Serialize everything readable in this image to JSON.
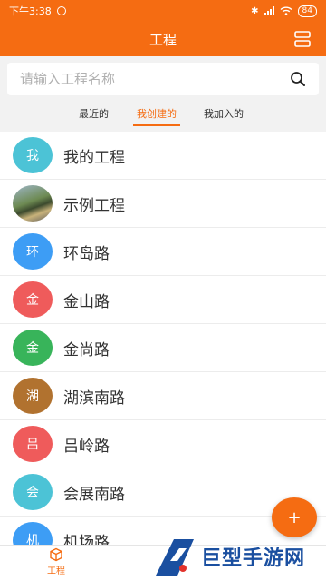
{
  "status_bar": {
    "time": "下午3:38",
    "battery": "84"
  },
  "header": {
    "title": "工程"
  },
  "search": {
    "placeholder": "请输入工程名称",
    "value": ""
  },
  "tabs": [
    {
      "label": "最近的",
      "active": false
    },
    {
      "label": "我创建的",
      "active": true
    },
    {
      "label": "我加入的",
      "active": false
    }
  ],
  "projects": [
    {
      "avatar_text": "我",
      "name": "我的工程",
      "color": "#4cc3d6"
    },
    {
      "avatar_text": "",
      "name": "示例工程",
      "color": "photo"
    },
    {
      "avatar_text": "环",
      "name": "环岛路",
      "color": "#3d9df5"
    },
    {
      "avatar_text": "金",
      "name": "金山路",
      "color": "#ef5b5b"
    },
    {
      "avatar_text": "金",
      "name": "金尚路",
      "color": "#38b45a"
    },
    {
      "avatar_text": "湖",
      "name": "湖滨南路",
      "color": "#b1722f"
    },
    {
      "avatar_text": "吕",
      "name": "吕岭路",
      "color": "#ef5b5b"
    },
    {
      "avatar_text": "会",
      "name": "会展南路",
      "color": "#4cc3d6"
    },
    {
      "avatar_text": "机",
      "name": "机场路",
      "color": "#3d9df5"
    }
  ],
  "fab": {
    "label": "+"
  },
  "bottom_nav": {
    "items": [
      {
        "label": "工程",
        "icon": "box-icon",
        "active": true
      }
    ]
  },
  "watermark": {
    "text": "巨型手游网"
  },
  "colors": {
    "accent": "#f56c12"
  }
}
